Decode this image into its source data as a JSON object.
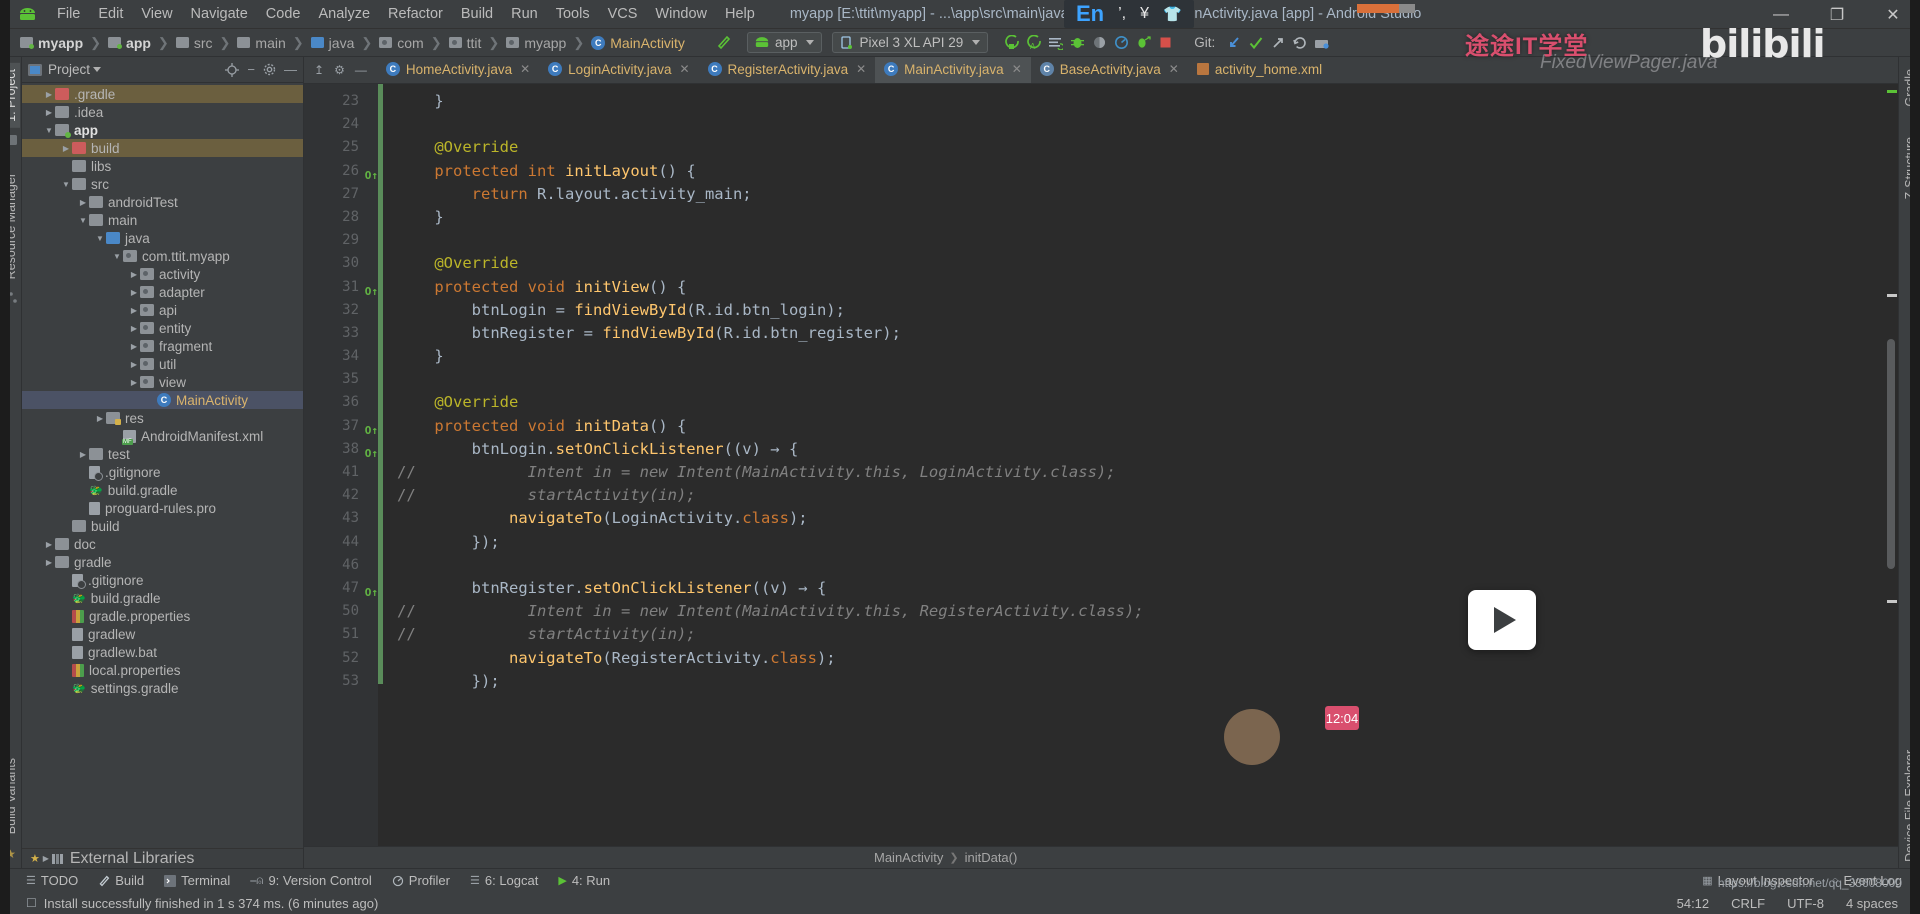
{
  "window": {
    "title": "myapp [E:\\ttit\\myapp] - ...\\app\\src\\main\\java\\com\\ttit\\myapp\\MainActivity.java [app] - Android Studio",
    "minimize": "—",
    "restore": "❐",
    "close": "✕",
    "app_icon": "android-robot-icon"
  },
  "ime": {
    "mode": "En",
    "punct": "’,",
    "currency": "¥",
    "shirt": "👕"
  },
  "menubar": [
    "File",
    "Edit",
    "View",
    "Navigate",
    "Code",
    "Analyze",
    "Refactor",
    "Build",
    "Run",
    "Tools",
    "VCS",
    "Window",
    "Help"
  ],
  "breadcrumbs": [
    {
      "label": "myapp",
      "icon": "folder-module-icon",
      "style": "bold"
    },
    {
      "label": "app",
      "icon": "folder-app-icon",
      "style": "bold"
    },
    {
      "label": "src",
      "icon": "folder-icon",
      "style": "normal"
    },
    {
      "label": "main",
      "icon": "folder-icon",
      "style": "normal"
    },
    {
      "label": "java",
      "icon": "folder-source-icon",
      "style": "normal"
    },
    {
      "label": "com",
      "icon": "package-icon",
      "style": "normal"
    },
    {
      "label": "ttit",
      "icon": "package-icon",
      "style": "normal"
    },
    {
      "label": "myapp",
      "icon": "package-icon",
      "style": "normal"
    },
    {
      "label": "MainActivity",
      "icon": "java-class-icon",
      "style": "class"
    }
  ],
  "toolbar": {
    "hammer_icon": "build-hammer-icon",
    "module_selector": "app",
    "device_selector": "Pixel 3 XL API 29",
    "run_icon": "run-icon",
    "run_coverage_icon": "run-with-coverage-icon",
    "apply_changes_icon": "apply-changes-icon",
    "debug_icon": "debug-icon",
    "profile_icon": "profile-icon",
    "monitor_icon": "android-profiler-icon",
    "attach_debugger_icon": "attach-debugger-icon",
    "stop_icon": "stop-icon",
    "git_label": "Git:",
    "git_update_icon": "update-project-icon",
    "git_commit_icon": "commit-icon",
    "git_push_icon": "push-icon",
    "git_history_icon": "history-icon",
    "git_branch_icon": "branch-icon"
  },
  "watermark": {
    "brand": "途途IT学堂",
    "site": "bilibili",
    "ghost": "FixedViewPager.java",
    "blog_url": "https://blog.csdn.net/qq_33608000",
    "clock": "12:04"
  },
  "project_panel": {
    "title": "Project",
    "header_icons": [
      "locate-icon",
      "collapse-all-icon",
      "settings-gear-icon",
      "hide-icon"
    ],
    "tree": [
      {
        "label": ".gradle",
        "depth": 1,
        "arrow": "collapsed",
        "icon": "folder-excluded-icon",
        "state": "highlight"
      },
      {
        "label": ".idea",
        "depth": 1,
        "arrow": "collapsed",
        "icon": "folder-icon",
        "state": "normal"
      },
      {
        "label": "app",
        "depth": 1,
        "arrow": "expanded",
        "icon": "folder-module-icon",
        "state": "bold"
      },
      {
        "label": "build",
        "depth": 2,
        "arrow": "collapsed",
        "icon": "folder-excluded-icon",
        "state": "highlight"
      },
      {
        "label": "libs",
        "depth": 2,
        "arrow": "none",
        "icon": "folder-icon",
        "state": "normal"
      },
      {
        "label": "src",
        "depth": 2,
        "arrow": "expanded",
        "icon": "folder-icon",
        "state": "normal"
      },
      {
        "label": "androidTest",
        "depth": 3,
        "arrow": "collapsed",
        "icon": "folder-icon",
        "state": "normal"
      },
      {
        "label": "main",
        "depth": 3,
        "arrow": "expanded",
        "icon": "folder-icon",
        "state": "normal"
      },
      {
        "label": "java",
        "depth": 4,
        "arrow": "expanded",
        "icon": "folder-source-icon",
        "state": "normal"
      },
      {
        "label": "com.ttit.myapp",
        "depth": 5,
        "arrow": "expanded",
        "icon": "package-icon",
        "state": "normal"
      },
      {
        "label": "activity",
        "depth": 6,
        "arrow": "collapsed",
        "icon": "package-icon",
        "state": "normal"
      },
      {
        "label": "adapter",
        "depth": 6,
        "arrow": "collapsed",
        "icon": "package-icon",
        "state": "normal"
      },
      {
        "label": "api",
        "depth": 6,
        "arrow": "collapsed",
        "icon": "package-icon",
        "state": "normal"
      },
      {
        "label": "entity",
        "depth": 6,
        "arrow": "collapsed",
        "icon": "package-icon",
        "state": "normal"
      },
      {
        "label": "fragment",
        "depth": 6,
        "arrow": "collapsed",
        "icon": "package-icon",
        "state": "normal"
      },
      {
        "label": "util",
        "depth": 6,
        "arrow": "collapsed",
        "icon": "package-icon",
        "state": "normal"
      },
      {
        "label": "view",
        "depth": 6,
        "arrow": "collapsed",
        "icon": "package-icon",
        "state": "normal"
      },
      {
        "label": "MainActivity",
        "depth": 7,
        "arrow": "none",
        "icon": "java-class-icon",
        "state": "selected"
      },
      {
        "label": "res",
        "depth": 4,
        "arrow": "collapsed",
        "icon": "folder-res-icon",
        "state": "normal"
      },
      {
        "label": "AndroidManifest.xml",
        "depth": 5,
        "arrow": "none",
        "icon": "manifest-icon",
        "state": "normal"
      },
      {
        "label": "test",
        "depth": 3,
        "arrow": "collapsed",
        "icon": "folder-icon",
        "state": "normal"
      },
      {
        "label": ".gitignore",
        "depth": 3,
        "arrow": "none",
        "icon": "gitignore-icon",
        "state": "normal"
      },
      {
        "label": "build.gradle",
        "depth": 3,
        "arrow": "none",
        "icon": "gradle-icon",
        "state": "normal"
      },
      {
        "label": "proguard-rules.pro",
        "depth": 3,
        "arrow": "none",
        "icon": "file-icon",
        "state": "normal"
      },
      {
        "label": "build",
        "depth": 2,
        "arrow": "none",
        "icon": "folder-icon",
        "state": "normal"
      },
      {
        "label": "doc",
        "depth": 1,
        "arrow": "collapsed",
        "icon": "folder-icon",
        "state": "normal"
      },
      {
        "label": "gradle",
        "depth": 1,
        "arrow": "collapsed",
        "icon": "folder-icon",
        "state": "normal"
      },
      {
        "label": ".gitignore",
        "depth": 2,
        "arrow": "none",
        "icon": "gitignore-icon",
        "state": "normal"
      },
      {
        "label": "build.gradle",
        "depth": 2,
        "arrow": "none",
        "icon": "gradle-icon",
        "state": "normal"
      },
      {
        "label": "gradle.properties",
        "depth": 2,
        "arrow": "none",
        "icon": "properties-icon",
        "state": "normal"
      },
      {
        "label": "gradlew",
        "depth": 2,
        "arrow": "none",
        "icon": "file-icon",
        "state": "normal"
      },
      {
        "label": "gradlew.bat",
        "depth": 2,
        "arrow": "none",
        "icon": "file-icon",
        "state": "normal"
      },
      {
        "label": "local.properties",
        "depth": 2,
        "arrow": "none",
        "icon": "properties-icon",
        "state": "normal"
      },
      {
        "label": "settings.gradle",
        "depth": 2,
        "arrow": "none",
        "icon": "gradle-icon",
        "state": "normal"
      }
    ],
    "external_libraries": "External Libraries"
  },
  "left_strips": {
    "top": [
      "1: Project"
    ],
    "middle": [
      "Resource Manager"
    ],
    "bottom": [
      "Build Variants",
      "2: Favorites"
    ]
  },
  "right_strips": [
    "Gradle",
    "Z-Structure",
    "Device File Explorer"
  ],
  "editor_tabs": [
    {
      "label": "HomeActivity.java",
      "icon": "java-class-icon",
      "active": false
    },
    {
      "label": "LoginActivity.java",
      "icon": "java-class-icon",
      "active": false
    },
    {
      "label": "RegisterActivity.java",
      "icon": "java-class-icon",
      "active": false
    },
    {
      "label": "MainActivity.java",
      "icon": "java-class-icon",
      "active": true
    },
    {
      "label": "BaseActivity.java",
      "icon": "java-abstract-class-icon",
      "active": false
    },
    {
      "label": "activity_home.xml",
      "icon": "android-layout-xml-icon",
      "active": false
    }
  ],
  "code": {
    "lines": [
      {
        "num": "23",
        "mark": "",
        "changed": true,
        "html": "    }"
      },
      {
        "num": "24",
        "mark": "",
        "changed": true,
        "html": ""
      },
      {
        "num": "25",
        "mark": "",
        "changed": true,
        "html": "    <span class='ann'>@Override</span>"
      },
      {
        "num": "26",
        "mark": "O↑",
        "changed": true,
        "html": "    <span class='kw'>protected</span> <span class='kw'>int</span> <span class='fn'>initLayout</span>() {"
      },
      {
        "num": "27",
        "mark": "",
        "changed": true,
        "html": "        <span class='kw'>return</span> R.layout.activity_main;"
      },
      {
        "num": "28",
        "mark": "",
        "changed": true,
        "html": "    }"
      },
      {
        "num": "29",
        "mark": "",
        "changed": true,
        "html": ""
      },
      {
        "num": "30",
        "mark": "",
        "changed": true,
        "html": "    <span class='ann'>@Override</span>"
      },
      {
        "num": "31",
        "mark": "O↑",
        "changed": true,
        "html": "    <span class='kw'>protected</span> <span class='kw'>void</span> <span class='fn'>initView</span>() {"
      },
      {
        "num": "32",
        "mark": "",
        "changed": true,
        "html": "        btnLogin = <span class='fn'>findViewById</span>(R.id.btn_login);"
      },
      {
        "num": "33",
        "mark": "",
        "changed": true,
        "html": "        btnRegister = <span class='fn'>findViewById</span>(R.id.btn_register);"
      },
      {
        "num": "34",
        "mark": "",
        "changed": true,
        "html": "    }"
      },
      {
        "num": "35",
        "mark": "",
        "changed": true,
        "html": ""
      },
      {
        "num": "36",
        "mark": "",
        "changed": true,
        "html": "    <span class='ann'>@Override</span>"
      },
      {
        "num": "37",
        "mark": "O↑",
        "changed": true,
        "html": "    <span class='kw'>protected</span> <span class='kw'>void</span> <span class='fn'>initData</span>() {"
      },
      {
        "num": "38",
        "mark": "O↑",
        "changed": true,
        "html": "        btnLogin.<span class='fn'>setOnClickListener</span>((v) → {"
      },
      {
        "num": "41",
        "mark": "",
        "changed": true,
        "html": "<span class='cmtm'>//</span>            <span class='cmt'>Intent in = new Intent(MainActivity.this, LoginActivity.class);</span>"
      },
      {
        "num": "42",
        "mark": "",
        "changed": true,
        "html": "<span class='cmtm'>//</span>            <span class='cmt'>startActivity(in);</span>"
      },
      {
        "num": "43",
        "mark": "",
        "changed": true,
        "html": "            <span class='fn'>navigateTo</span>(LoginActivity.<span class='kw'>class</span>);"
      },
      {
        "num": "44",
        "mark": "",
        "changed": true,
        "html": "        });"
      },
      {
        "num": "46",
        "mark": "",
        "changed": true,
        "html": ""
      },
      {
        "num": "47",
        "mark": "O↑",
        "changed": true,
        "html": "        btnRegister.<span class='fn'>setOnClickListener</span>((v) → {"
      },
      {
        "num": "50",
        "mark": "",
        "changed": true,
        "html": "<span class='cmtm'>//</span>            <span class='cmt'>Intent in = new Intent(MainActivity.this, RegisterActivity.class);</span>"
      },
      {
        "num": "51",
        "mark": "",
        "changed": true,
        "html": "<span class='cmtm'>//</span>            <span class='cmt'>startActivity(in);</span>"
      },
      {
        "num": "52",
        "mark": "",
        "changed": true,
        "html": "            <span class='fn'>navigateTo</span>(RegisterActivity.<span class='kw'>class</span>);"
      },
      {
        "num": "53",
        "mark": "",
        "changed": true,
        "html": "        });"
      }
    ]
  },
  "editor_breadcrumb": [
    "MainActivity",
    "initData()"
  ],
  "toolwindow_bar": [
    {
      "label": "TODO",
      "icon": "todo-icon"
    },
    {
      "label": "Build",
      "icon": "build-hammer-icon"
    },
    {
      "label": "Terminal",
      "icon": "terminal-icon"
    },
    {
      "label": "9: Version Control",
      "icon": "version-control-icon"
    },
    {
      "label": "Profiler",
      "icon": "profiler-icon"
    },
    {
      "label": "6: Logcat",
      "icon": "logcat-icon"
    },
    {
      "label": "4: Run",
      "icon": "run-icon"
    }
  ],
  "toolwindow_right": [
    {
      "label": "Layout Inspector",
      "icon": "layout-inspector-icon"
    },
    {
      "label": "Event Log",
      "icon": "event-log-icon"
    }
  ],
  "statusbar": {
    "message": "Install successfully finished in 1 s 374 ms. (6 minutes ago)",
    "message_icon": "info-icon",
    "caret_position": "54:12",
    "line_separator": "CRLF",
    "encoding": "UTF-8",
    "indent": "4 spaces"
  }
}
